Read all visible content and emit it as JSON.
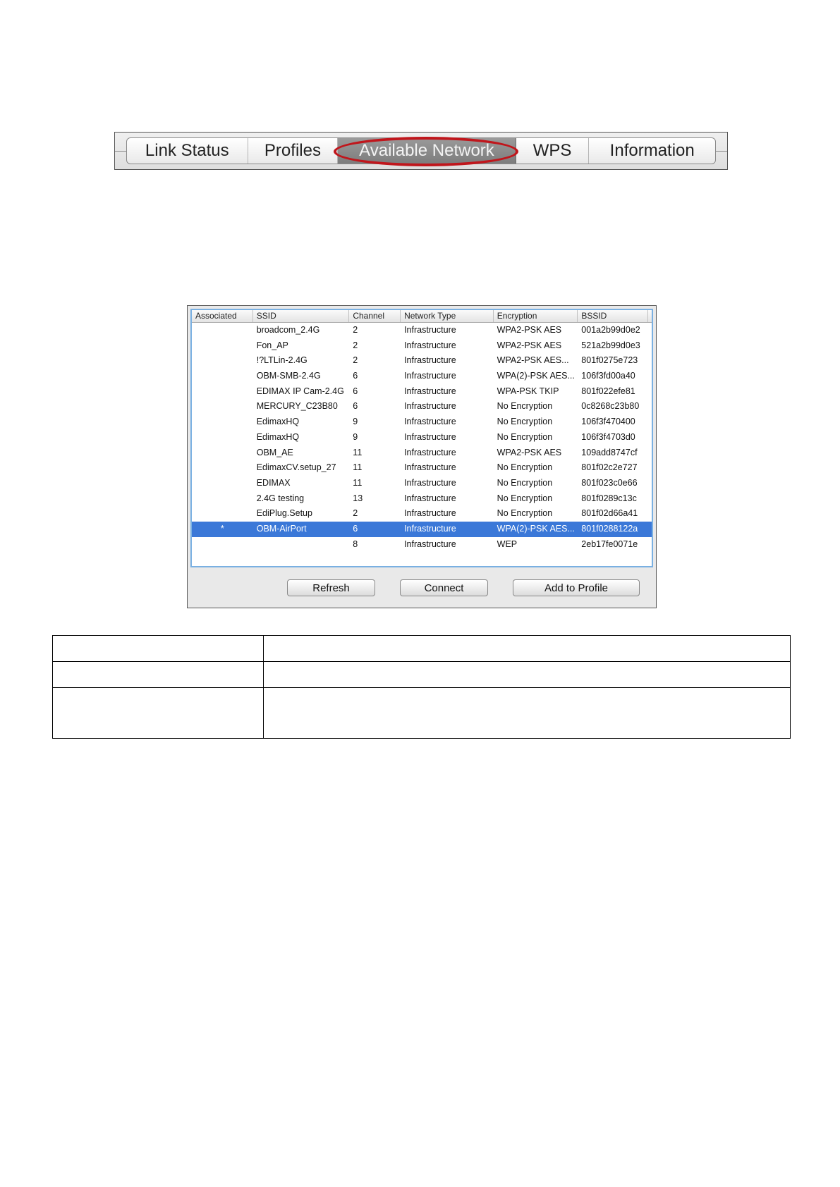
{
  "tabs": [
    {
      "label": "Link Status",
      "selected": false
    },
    {
      "label": "Profiles",
      "selected": false
    },
    {
      "label": "Available Network",
      "selected": true
    },
    {
      "label": "WPS",
      "selected": false
    },
    {
      "label": "Information",
      "selected": false
    }
  ],
  "highlight_color": "#c0161c",
  "network_list": {
    "columns": [
      "Associated",
      "SSID",
      "Channel",
      "Network Type",
      "Encryption",
      "BSSID"
    ],
    "rows": [
      {
        "associated": "",
        "ssid": "broadcom_2.4G",
        "channel": "2",
        "type": "Infrastructure",
        "encryption": "WPA2-PSK AES",
        "bssid": "001a2b99d0e2",
        "selected": false
      },
      {
        "associated": "",
        "ssid": "Fon_AP",
        "channel": "2",
        "type": "Infrastructure",
        "encryption": "WPA2-PSK AES",
        "bssid": "521a2b99d0e3",
        "selected": false
      },
      {
        "associated": "",
        "ssid": "!?LTLin-2.4G",
        "channel": "2",
        "type": "Infrastructure",
        "encryption": "WPA2-PSK AES...",
        "bssid": "801f0275e723",
        "selected": false
      },
      {
        "associated": "",
        "ssid": "OBM-SMB-2.4G",
        "channel": "6",
        "type": "Infrastructure",
        "encryption": "WPA(2)-PSK AES...",
        "bssid": "106f3fd00a40",
        "selected": false
      },
      {
        "associated": "",
        "ssid": "EDIMAX IP Cam-2.4G",
        "channel": "6",
        "type": "Infrastructure",
        "encryption": "WPA-PSK TKIP",
        "bssid": "801f022efe81",
        "selected": false
      },
      {
        "associated": "",
        "ssid": "MERCURY_C23B80",
        "channel": "6",
        "type": "Infrastructure",
        "encryption": "No Encryption",
        "bssid": "0c8268c23b80",
        "selected": false
      },
      {
        "associated": "",
        "ssid": "EdimaxHQ",
        "channel": "9",
        "type": "Infrastructure",
        "encryption": "No Encryption",
        "bssid": "106f3f470400",
        "selected": false
      },
      {
        "associated": "",
        "ssid": "EdimaxHQ",
        "channel": "9",
        "type": "Infrastructure",
        "encryption": "No Encryption",
        "bssid": "106f3f4703d0",
        "selected": false
      },
      {
        "associated": "",
        "ssid": "OBM_AE",
        "channel": "11",
        "type": "Infrastructure",
        "encryption": "WPA2-PSK AES",
        "bssid": "109add8747cf",
        "selected": false
      },
      {
        "associated": "",
        "ssid": "EdimaxCV.setup_27",
        "channel": "11",
        "type": "Infrastructure",
        "encryption": "No Encryption",
        "bssid": "801f02c2e727",
        "selected": false
      },
      {
        "associated": "",
        "ssid": "EDIMAX",
        "channel": "11",
        "type": "Infrastructure",
        "encryption": "No Encryption",
        "bssid": "801f023c0e66",
        "selected": false
      },
      {
        "associated": "",
        "ssid": "2.4G testing",
        "channel": "13",
        "type": "Infrastructure",
        "encryption": "No Encryption",
        "bssid": "801f0289c13c",
        "selected": false
      },
      {
        "associated": "",
        "ssid": "EdiPlug.Setup",
        "channel": "2",
        "type": "Infrastructure",
        "encryption": "No Encryption",
        "bssid": "801f02d66a41",
        "selected": false
      },
      {
        "associated": "*",
        "ssid": "OBM-AirPort",
        "channel": "6",
        "type": "Infrastructure",
        "encryption": "WPA(2)-PSK AES...",
        "bssid": "801f0288122a",
        "selected": true
      },
      {
        "associated": "",
        "ssid": "",
        "channel": "8",
        "type": "Infrastructure",
        "encryption": "WEP",
        "bssid": "2eb17fe0071e",
        "selected": false
      }
    ],
    "selection_color": "#3b78d8"
  },
  "buttons": {
    "refresh": "Refresh",
    "connect": "Connect",
    "add_to_profile": "Add to Profile"
  }
}
